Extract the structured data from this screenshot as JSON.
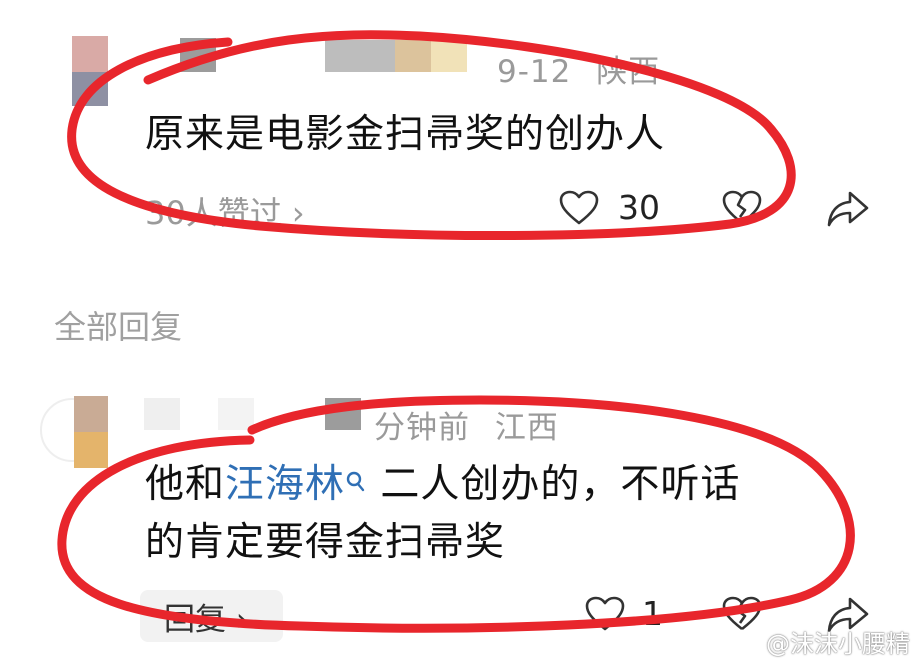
{
  "comment": {
    "date": "9-12",
    "location": "陕西",
    "text": "原来是电影金扫帚奖的创办人",
    "likers": "30人赞过 ›",
    "like_count": "30"
  },
  "section_header": "全部回复",
  "reply": {
    "time": "分钟前",
    "location": "江西",
    "text_prefix": "他和",
    "link_text": "汪海林",
    "text_suffix": " 二人创办的，不听话",
    "text_line2": "的肯定要得金扫帚奖",
    "reply_button": "回复 ›",
    "like_count": "1"
  },
  "watermark": "@沫沫小腰精",
  "colors": {
    "annotation": "#e8262c",
    "link": "#2f6fb5",
    "meta": "#9a9a9a"
  }
}
